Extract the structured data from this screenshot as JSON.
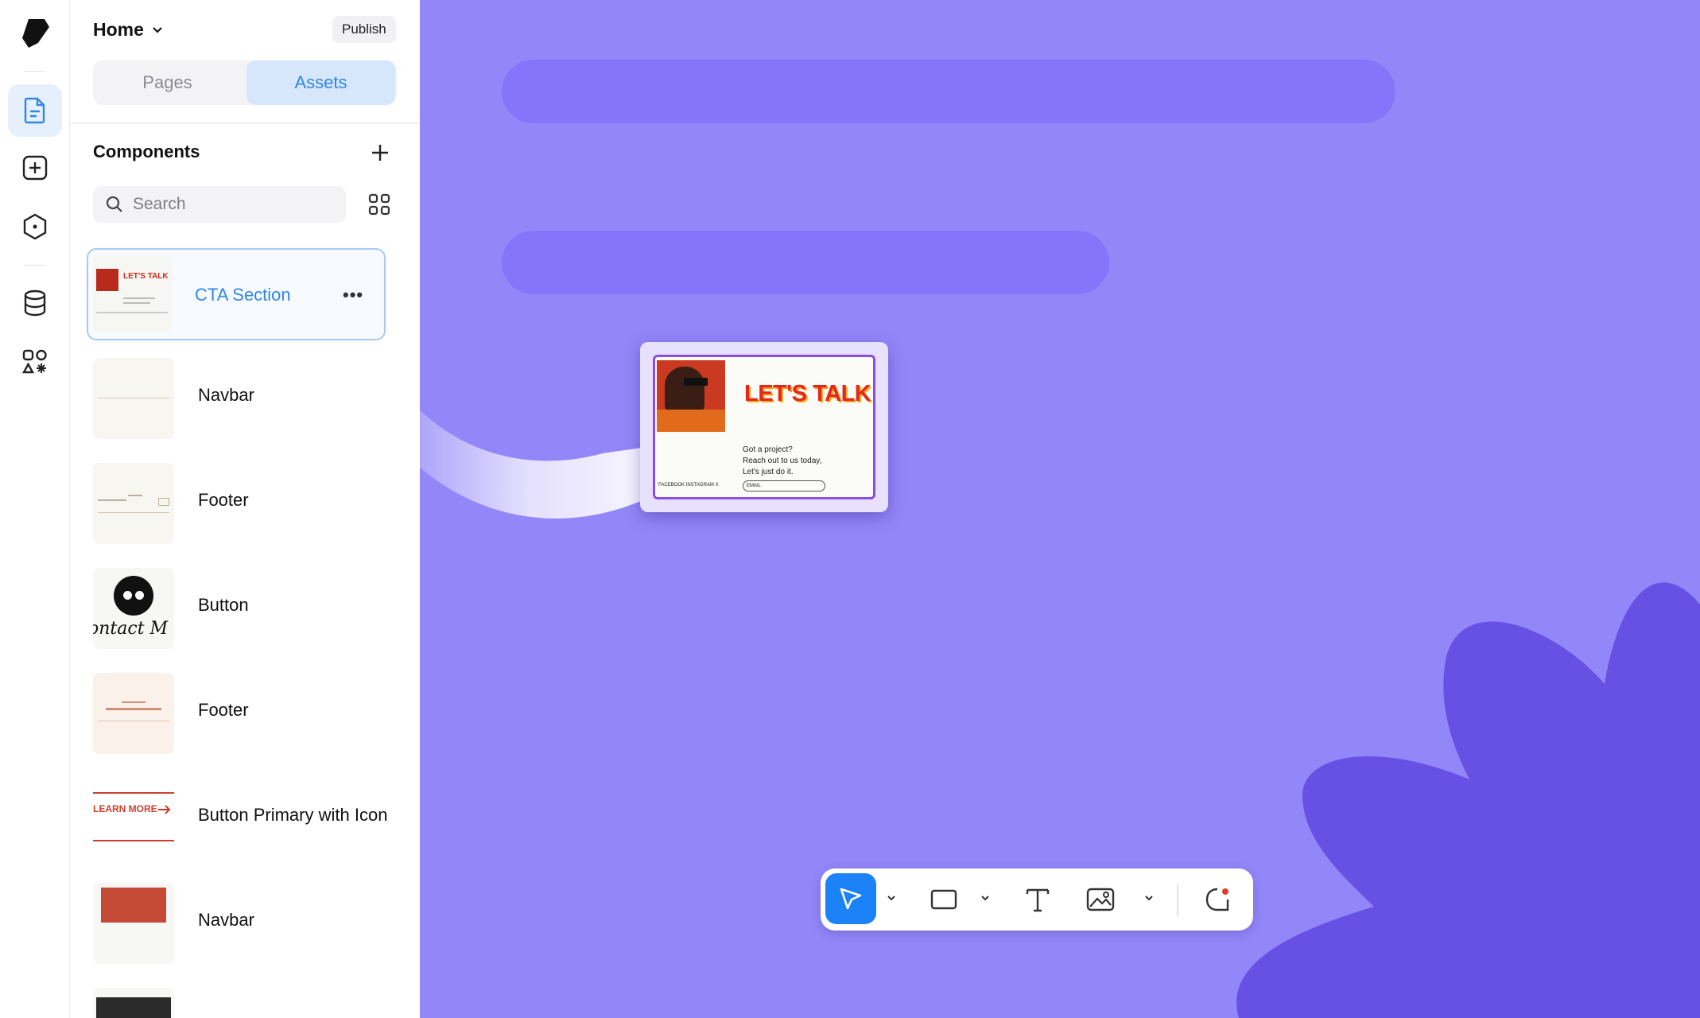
{
  "header": {
    "title": "Home",
    "publish_label": "Publish"
  },
  "tabs": {
    "pages": "Pages",
    "assets": "Assets",
    "active": "Assets"
  },
  "components": {
    "title": "Components",
    "search_placeholder": "Search",
    "items": [
      {
        "label": "CTA Section",
        "selected": true
      },
      {
        "label": "Navbar"
      },
      {
        "label": "Footer"
      },
      {
        "label": "Button",
        "thumb_text": "ontact M"
      },
      {
        "label": "Footer"
      },
      {
        "label": "Button Primary with Icon",
        "thumb_text": "LEARN MORE"
      },
      {
        "label": "Navbar"
      },
      {
        "label": ""
      }
    ]
  },
  "cta_thumb": {
    "title": "LET'S TALK"
  },
  "drag_preview": {
    "title": "LET'S TALK",
    "copy_1": "Got a project?",
    "copy_2": "Reach out to us today,",
    "copy_3": "Let's just do it.",
    "footer_text": "FACEBOOK   INSTAGRAM   X",
    "email_placeholder": "EMAIL"
  },
  "colors": {
    "canvas": "#9386f9",
    "accent": "#2f87e6",
    "tool_active": "#1b82f7",
    "placeholder_bar": "#8675fa",
    "flower": "#6750e4"
  },
  "icons": {
    "rail": [
      "logo-icon",
      "page-icon",
      "add-icon",
      "component-icon",
      "database-icon",
      "apps-icon"
    ],
    "toolbar": [
      "cursor-icon",
      "rectangle-icon",
      "text-icon",
      "image-icon",
      "comment-icon"
    ]
  }
}
